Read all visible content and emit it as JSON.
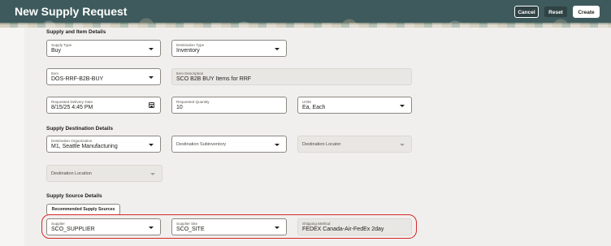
{
  "header": {
    "title": "New Supply Request",
    "cancel_label": "Cancel",
    "reset_label": "Reset",
    "create_label": "Create"
  },
  "sections": {
    "supply_item": "Supply and Item Details",
    "destination": "Supply Destination Details",
    "source": "Supply Source Details"
  },
  "fields": {
    "supply_type": {
      "label": "Supply Type",
      "value": "Buy"
    },
    "destination_type": {
      "label": "Destination Type",
      "value": "Inventory"
    },
    "item": {
      "label": "Item",
      "value": "DOS-RRF-B2B-BUY"
    },
    "item_description": {
      "label": "Item Description",
      "value": "SCO B2B BUY Items for RRF"
    },
    "requested_delivery_date": {
      "label": "Requested Delivery Date",
      "value": "8/15/25 4:45 PM"
    },
    "requested_quantity": {
      "label": "Requested Quantity",
      "value": "10"
    },
    "uom": {
      "label": "UOM",
      "value": "Ea, Each"
    },
    "destination_organization": {
      "label": "Destination Organization",
      "value": "M1, Seattle Manufacturing"
    },
    "destination_subinventory": {
      "label": "Destination Subinventory"
    },
    "destination_locator": {
      "label": "Destination Locator"
    },
    "destination_location": {
      "label": "Destination Location"
    },
    "supplier": {
      "label": "Supplier",
      "value": "SCO_SUPPLIER"
    },
    "supplier_site": {
      "label": "Supplier Site",
      "value": "SCO_SITE"
    },
    "shipping_method": {
      "label": "Shipping Method",
      "value": "FEDEX Canada-Air-FedEx 2day"
    }
  },
  "recommended_sources_label": "Recommended Supply Sources",
  "colors": {
    "header_bg": "#3e5a5c",
    "highlight": "#d22a2a"
  }
}
